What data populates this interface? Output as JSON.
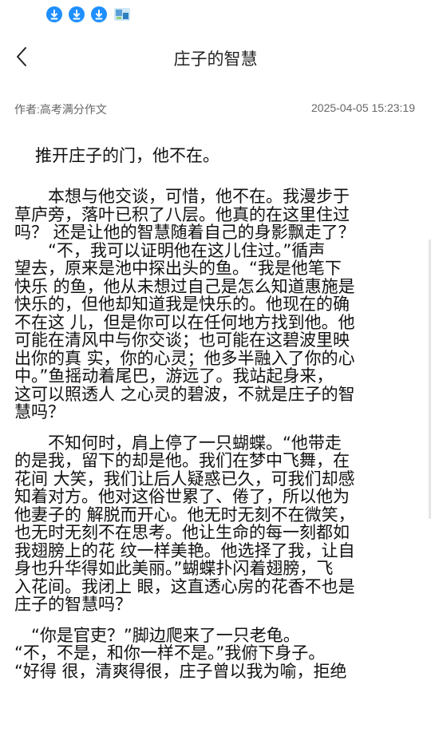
{
  "status": {
    "icons": [
      "download-icon",
      "download-icon",
      "download-icon",
      "app-thumbnail-icon"
    ],
    "accent": "#1f8fff"
  },
  "nav": {
    "back_icon": "chevron-left-icon",
    "title": "庄子的智慧"
  },
  "meta": {
    "author": "作者:高考满分作文",
    "date": "2025-04-05 15:23:19"
  },
  "article": {
    "lead": "推开庄子的门，他不在。",
    "paragraphs": [
      [
        "　　本想与他交谈，可惜，他不在。我漫步于",
        "草庐旁，落叶已积了八层。他真的在这里住过",
        "吗？ 还是让他的智慧随着自己的身影飘走了？",
        "　　“不，我可以证明他在这儿住过。”循声",
        "望去，原来是池中探出头的鱼。“我是他笔下",
        "快乐 的鱼，他从未想过自己是怎么知道惠施是",
        "快乐的，但他却知道我是快乐的。他现在的确",
        "不在这 儿，但是你可以在任何地方找到他。他",
        "可能在清风中与你交谈；也可能在这碧波里映",
        "出你的真 实，你的心灵；他多半融入了你的心",
        "中。”鱼摇动着尾巴，游远了。我站起身来，",
        "这可以照透人 之心灵的碧波，不就是庄子的智",
        "慧吗？"
      ],
      [
        "　　不知何时，肩上停了一只蝴蝶。“他带走",
        "的是我，留下的却是他。我们在梦中飞舞，在",
        "花间 大笑，我们让后人疑惑已久，可我们却感",
        "知着对方。他对这俗世累了、倦了，所以他为",
        "他妻子的 解脱而开心。他无时无刻不在微笑，",
        "也无时无刻不在思考。他让生命的每一刻都如",
        "我翅膀上的花 纹一样美艳。他选择了我，让自",
        "身也升华得如此美丽。”蝴蝶扑闪着翅膀，飞",
        "入花间。我闭上 眼，这直透心房的花香不也是",
        "庄子的智慧吗？"
      ],
      [
        "　“你是官吏？”脚边爬来了一只老龟。",
        "“不，不是，和你一样不是。”我俯下身子。",
        "“好得 很，清爽得很，庄子曾以我为喻，拒绝"
      ]
    ]
  }
}
